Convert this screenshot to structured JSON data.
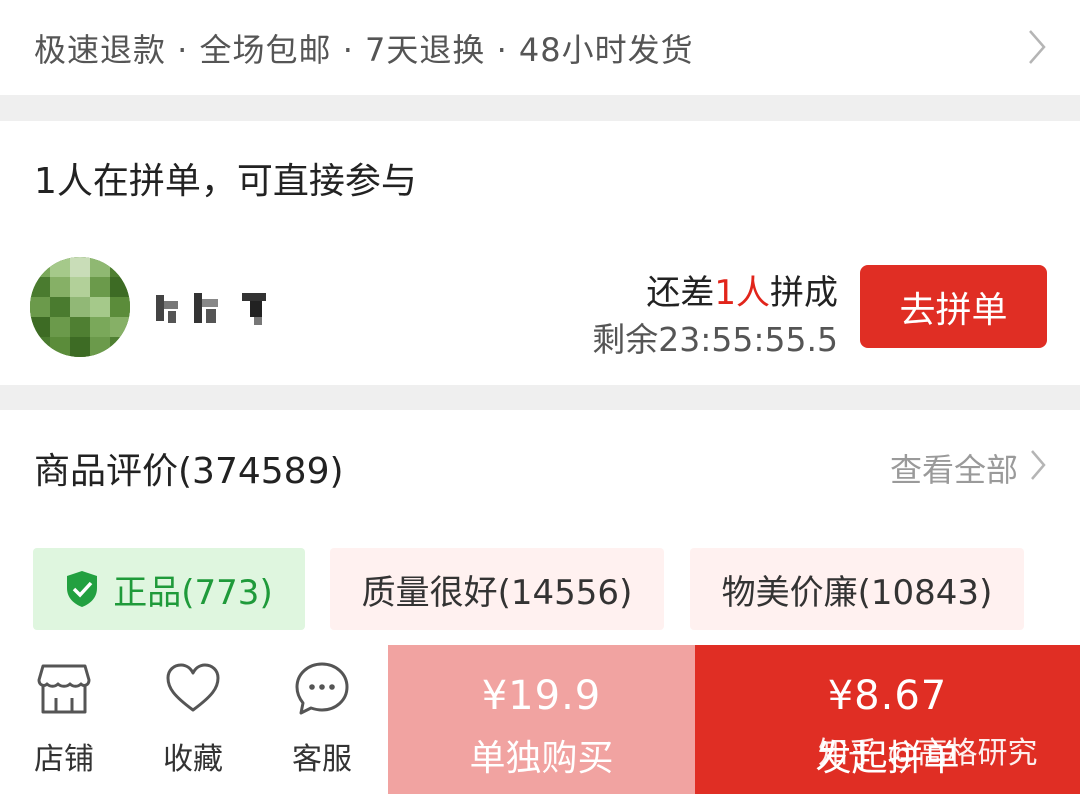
{
  "service_bar": {
    "text": "极速退款 · 全场包邮 · 7天退换 · 48小时发货",
    "chevron_icon": "chevron-right-icon"
  },
  "group_buy": {
    "title": "1人在拼单，可直接参与",
    "need_prefix": "还差",
    "need_count": "1人",
    "need_suffix": "拼成",
    "countdown": "剩余23:55:55.5",
    "join_label": "去拼单"
  },
  "reviews": {
    "title": "商品评价(374589)",
    "view_all": "查看全部",
    "tags": [
      {
        "label": "正品(773)",
        "icon": "shield-check-icon"
      },
      {
        "label": "质量很好(14556)"
      },
      {
        "label": "物美价廉(10843)"
      }
    ]
  },
  "bottom_bar": {
    "nav": [
      {
        "label": "店铺",
        "icon": "store-icon"
      },
      {
        "label": "收藏",
        "icon": "heart-icon"
      },
      {
        "label": "客服",
        "icon": "chat-icon"
      }
    ],
    "solo": {
      "price": "¥19.9",
      "label": "单独购买"
    },
    "group": {
      "price": "¥8.67",
      "label": "发起拼单"
    }
  },
  "watermark": "知乎 @高格研究",
  "colors": {
    "accent_red": "#e02e24",
    "light_red": "#f1a3a1",
    "genuine_green": "#1f9a3a"
  }
}
